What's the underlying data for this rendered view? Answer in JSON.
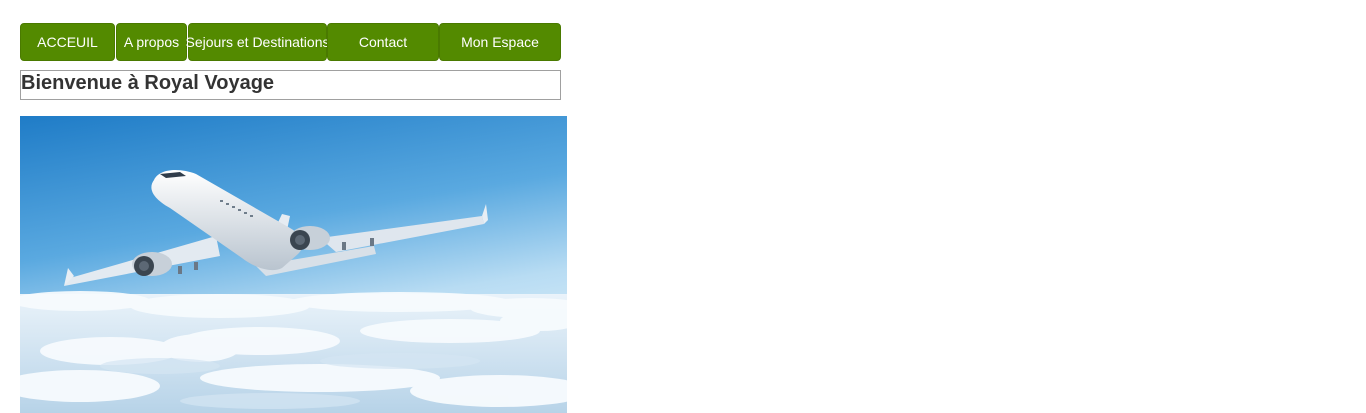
{
  "nav": {
    "items": [
      {
        "label": "ACCEUIL"
      },
      {
        "label": "A propos"
      },
      {
        "label": "Sejours et Destinations"
      },
      {
        "label": "Contact"
      },
      {
        "label": "Mon Espace"
      }
    ]
  },
  "header": {
    "title": "Bienvenue à Royal Voyage"
  },
  "hero": {
    "icon": "airplane-in-sky-image",
    "colors": {
      "sky_top": "#2a86cf",
      "sky_bottom": "#cfe6f6",
      "cloud": "#f4f8fb"
    }
  },
  "colors": {
    "nav_green": "#538a00",
    "nav_text": "#ffffff",
    "title_text": "#333333",
    "title_border": "#a0a0a0"
  }
}
